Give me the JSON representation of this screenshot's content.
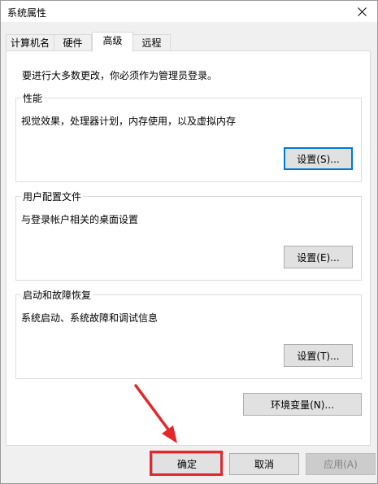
{
  "window": {
    "title": "系统属性"
  },
  "tabs": [
    {
      "label": "计算机名"
    },
    {
      "label": "硬件"
    },
    {
      "label": "高级",
      "active": true
    },
    {
      "label": "远程"
    }
  ],
  "panel": {
    "note": "要进行大多数更改，你必须作为管理员登录。",
    "groups": [
      {
        "title": "性能",
        "description": "视觉效果，处理器计划，内存使用，以及虚拟内存",
        "button": "设置(S)..."
      },
      {
        "title": "用户配置文件",
        "description": "与登录帐户相关的桌面设置",
        "button": "设置(E)..."
      },
      {
        "title": "启动和故障恢复",
        "description": "系统启动、系统故障和调试信息",
        "button": "设置(T)..."
      }
    ],
    "env_button": "环境变量(N)..."
  },
  "footer": {
    "ok": "确定",
    "cancel": "取消",
    "apply": "应用(A)"
  },
  "annotation": {
    "color": "#e5262b"
  }
}
